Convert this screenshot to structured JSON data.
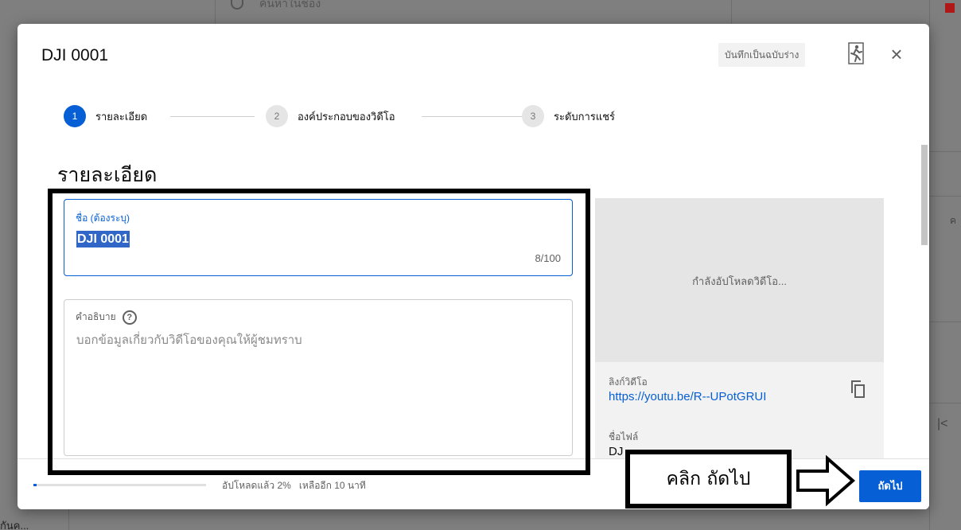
{
  "background": {
    "search_text": "ค้นหาในช่อง",
    "bottom_text": "กันค..."
  },
  "dialog": {
    "title": "DJI 0001",
    "draft_badge": "บันทึกเป็นฉบับร่าง",
    "icons": {
      "runner": "runner-icon",
      "close": "close-icon",
      "help": "help-icon",
      "copy": "copy-icon"
    }
  },
  "stepper": {
    "steps": [
      {
        "number": "1",
        "label": "รายละเอียด",
        "active": true
      },
      {
        "number": "2",
        "label": "องค์ประกอบของวิดีโอ",
        "active": false
      },
      {
        "number": "3",
        "label": "ระดับการแชร์",
        "active": false
      }
    ]
  },
  "details": {
    "heading": "รายละเอียด",
    "title_field": {
      "label": "ชื่อ (ต้องระบุ)",
      "value": "DJI 0001",
      "counter": "8/100"
    },
    "description_field": {
      "label": "คำอธิบาย",
      "placeholder": "บอกข้อมูลเกี่ยวกับวิดีโอของคุณให้ผู้ชมทราบ"
    }
  },
  "preview": {
    "status": "กำลังอัปโหลดวิดีโอ...",
    "link_label": "ลิงก์วิดีโอ",
    "link_value": "https://youtu.be/R--UPotGRUI",
    "file_label": "ชื่อไฟล์",
    "file_value": "DJ"
  },
  "footer": {
    "upload_status": "อัปโหลดแล้ว 2%   เหลืออีก 10 นาที",
    "upload_percent": 2,
    "next_label": "ถัดไป"
  },
  "annotation": {
    "label": "คลิก ถัดไป"
  },
  "colors": {
    "accent": "#065fd4",
    "annotation": "#000000"
  }
}
